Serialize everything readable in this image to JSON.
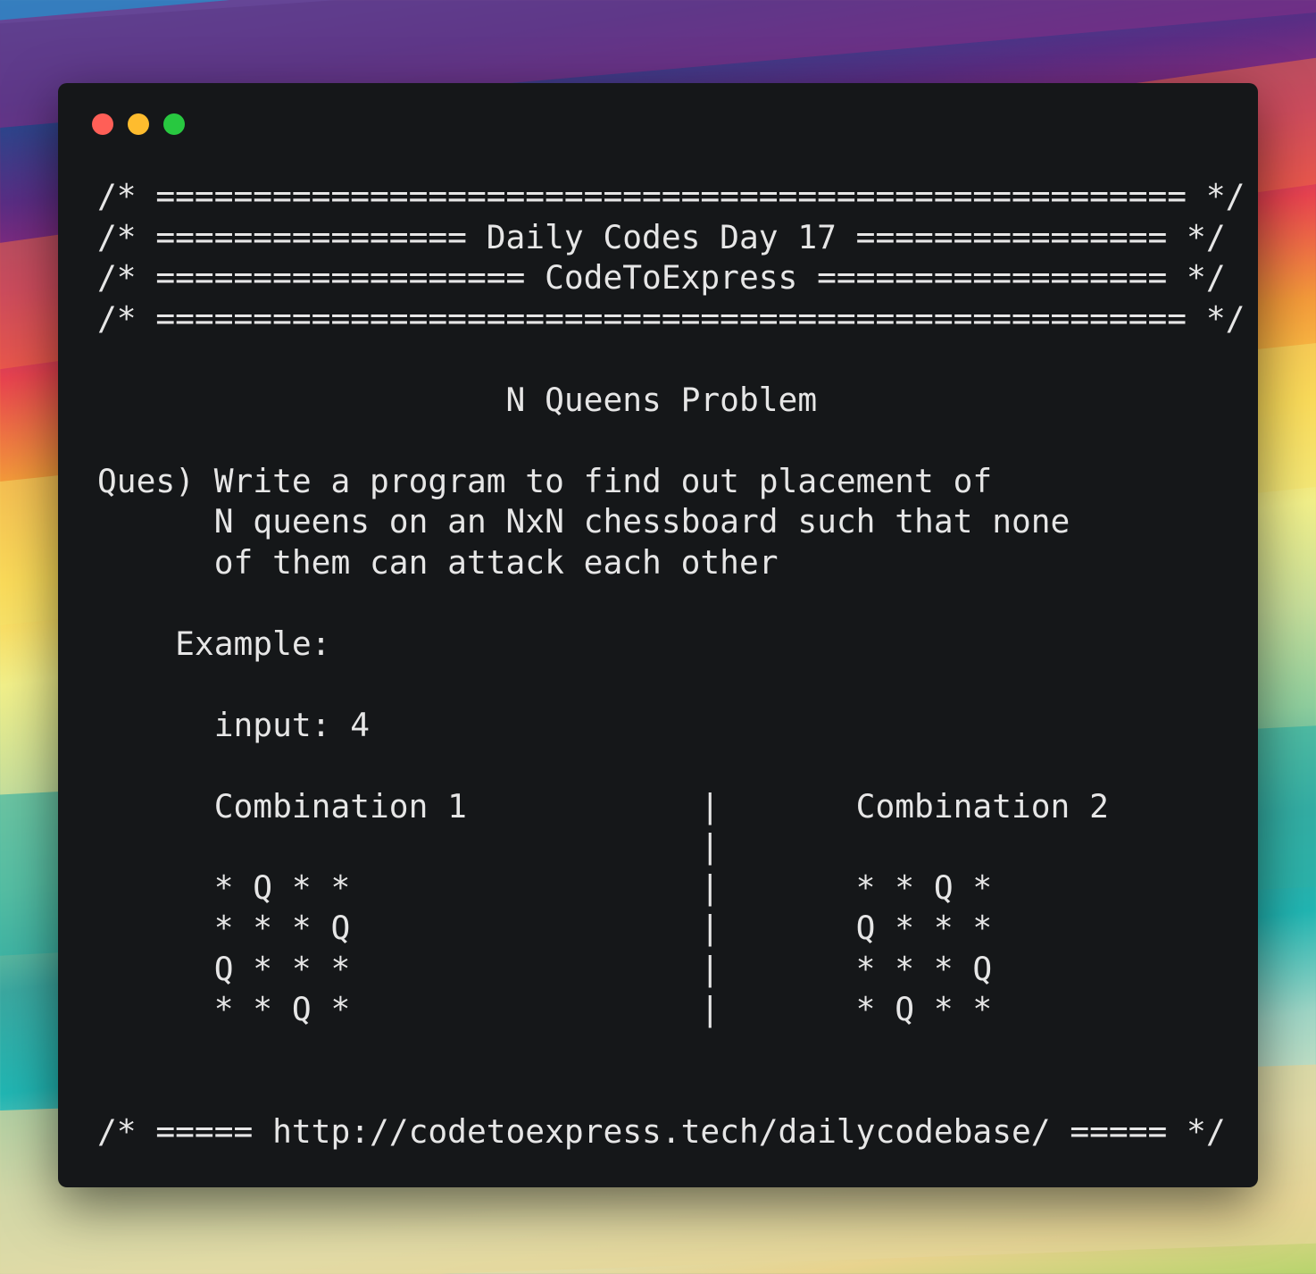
{
  "window": {
    "controls": [
      {
        "name": "close",
        "color": "#ff5f57"
      },
      {
        "name": "minimize",
        "color": "#febc2e"
      },
      {
        "name": "maximize",
        "color": "#28c840"
      }
    ]
  },
  "code": {
    "lines": [
      "/* ===================================================== */",
      "/* ================ Daily Codes Day 17 ================ */",
      "/* =================== CodeToExpress ================== */",
      "/* ===================================================== */",
      "",
      "                     N Queens Problem",
      "",
      "Ques) Write a program to find out placement of",
      "      N queens on an NxN chessboard such that none",
      "      of them can attack each other",
      "",
      "    Example:",
      "",
      "      input: 4",
      "",
      "      Combination 1            |       Combination 2",
      "                               |",
      "      * Q * *                  |       * * Q *",
      "      * * * Q                  |       Q * * *",
      "      Q * * *                  |       * * * Q",
      "      * * Q *                  |       * Q * *",
      "",
      "",
      "/* ===== http://codetoexpress.tech/dailycodebase/ ===== */"
    ]
  }
}
